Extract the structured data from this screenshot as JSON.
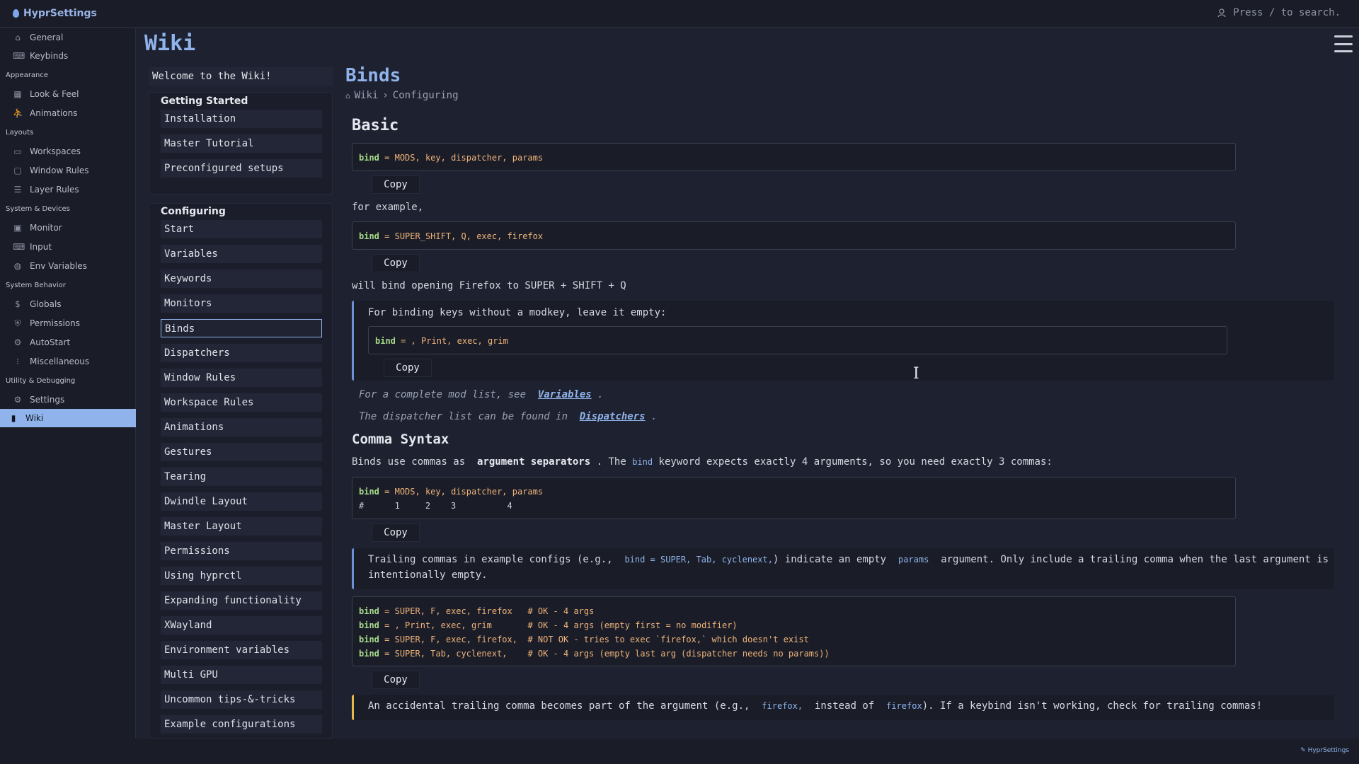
{
  "app": {
    "title": "HyprSettings",
    "search_hint": "Press / to search.",
    "footer_brand": "HyprSettings"
  },
  "sidebar": {
    "items_top": [
      {
        "label": "General",
        "icon": "home-icon"
      },
      {
        "label": "Keybinds",
        "icon": "keyboard-icon"
      }
    ],
    "groups": [
      {
        "title": "Appearance",
        "items": [
          {
            "label": "Look & Feel",
            "icon": "brush-icon"
          },
          {
            "label": "Animations",
            "icon": "run-icon"
          }
        ]
      },
      {
        "title": "Layouts",
        "items": [
          {
            "label": "Workspaces",
            "icon": "window-icon"
          },
          {
            "label": "Window Rules",
            "icon": "window-rule-icon"
          },
          {
            "label": "Layer Rules",
            "icon": "layers-icon"
          }
        ]
      },
      {
        "title": "System & Devices",
        "items": [
          {
            "label": "Monitor",
            "icon": "monitor-icon"
          },
          {
            "label": "Input",
            "icon": "input-icon"
          },
          {
            "label": "Env Variables",
            "icon": "globe-icon"
          }
        ]
      },
      {
        "title": "System Behavior",
        "items": [
          {
            "label": "Globals",
            "icon": "dollar-icon"
          },
          {
            "label": "Permissions",
            "icon": "shield-icon"
          },
          {
            "label": "AutoStart",
            "icon": "autostart-icon"
          },
          {
            "label": "Miscellaneous",
            "icon": "misc-icon"
          }
        ]
      },
      {
        "title": "Utility & Debugging",
        "items": [
          {
            "label": "Settings",
            "icon": "gear-icon"
          },
          {
            "label": "Wiki",
            "icon": "book-icon"
          }
        ]
      }
    ]
  },
  "wiki": {
    "title": "Wiki",
    "welcome": "Welcome to the Wiki!",
    "getting_started": {
      "title": "Getting Started",
      "items": [
        "Installation",
        "Master Tutorial",
        "Preconfigured setups"
      ]
    },
    "configuring": {
      "title": "Configuring",
      "items": [
        "Start",
        "Variables",
        "Keywords",
        "Monitors",
        "Binds",
        "Dispatchers",
        "Window Rules",
        "Workspace Rules",
        "Animations",
        "Gestures",
        "Tearing",
        "Dwindle Layout",
        "Master Layout",
        "Permissions",
        "Using hyprctl",
        "Expanding functionality",
        "XWayland",
        "Environment variables",
        "Multi GPU",
        "Uncommon tips-&-tricks",
        "Example configurations"
      ],
      "active": "Binds"
    }
  },
  "article": {
    "title": "Binds",
    "breadcrumb": [
      "Wiki",
      "Configuring"
    ],
    "basic": {
      "heading": "Basic",
      "code1": "MODS, key, dispatcher, params",
      "copy": "Copy",
      "for_example": "for example,",
      "code2": "SUPER_SHIFT, Q, exec, firefox",
      "explain": "will bind opening Firefox to SUPER + SHIFT + Q",
      "note_text": "For binding keys without a modkey, leave it empty:",
      "note_code": ", Print, exec, grim",
      "mod_list_prefix": "For a complete mod list, see",
      "mod_list_link": "Variables",
      "dispatcher_prefix": "The dispatcher list can be found in",
      "dispatcher_link": "Dispatchers",
      "period": "."
    },
    "comma": {
      "heading": "Comma Syntax",
      "intro_a": "Binds use commas as",
      "intro_b": "argument separators",
      "intro_c": ". The",
      "intro_d": "bind",
      "intro_e": "keyword expects exactly 4 arguments, so you need exactly 3 commas:",
      "code_line1": "MODS, key, dispatcher, params",
      "code_line2": "#      1     2    3          4",
      "note_a": "Trailing commas in example configs (e.g.,",
      "note_code": "bind = SUPER, Tab, cyclenext,",
      "note_b": ") indicate an empty",
      "note_params": "params",
      "note_c": "argument. Only include a trailing comma when the last argument is",
      "note_d": "intentionally empty.",
      "examples": [
        {
          "args": "SUPER, F, exec, firefox   ",
          "comment": "# OK - 4 args"
        },
        {
          "args": ", Print, exec, grim       ",
          "comment": "# OK - 4 args (empty first = no modifier)"
        },
        {
          "args": "SUPER, F, exec, firefox,  ",
          "comment": "# NOT OK - tries to exec `firefox,` which doesn't exist"
        },
        {
          "args": "SUPER, Tab, cyclenext,    ",
          "comment": "# OK - 4 args (empty last arg (dispatcher needs no params))"
        }
      ],
      "warn_a": "An accidental trailing comma becomes part of the argument (e.g.,",
      "warn_code1": "firefox,",
      "warn_b": "instead of",
      "warn_code2": "firefox",
      "warn_c": "). If a keybind isn't working, check for trailing commas!"
    },
    "bind_kw": "bind",
    "eq": " = "
  },
  "colors": {
    "accent": "#8fb3ea",
    "warn": "#e6b84a",
    "keyword": "#a6d98a",
    "value": "#f0b37a"
  }
}
